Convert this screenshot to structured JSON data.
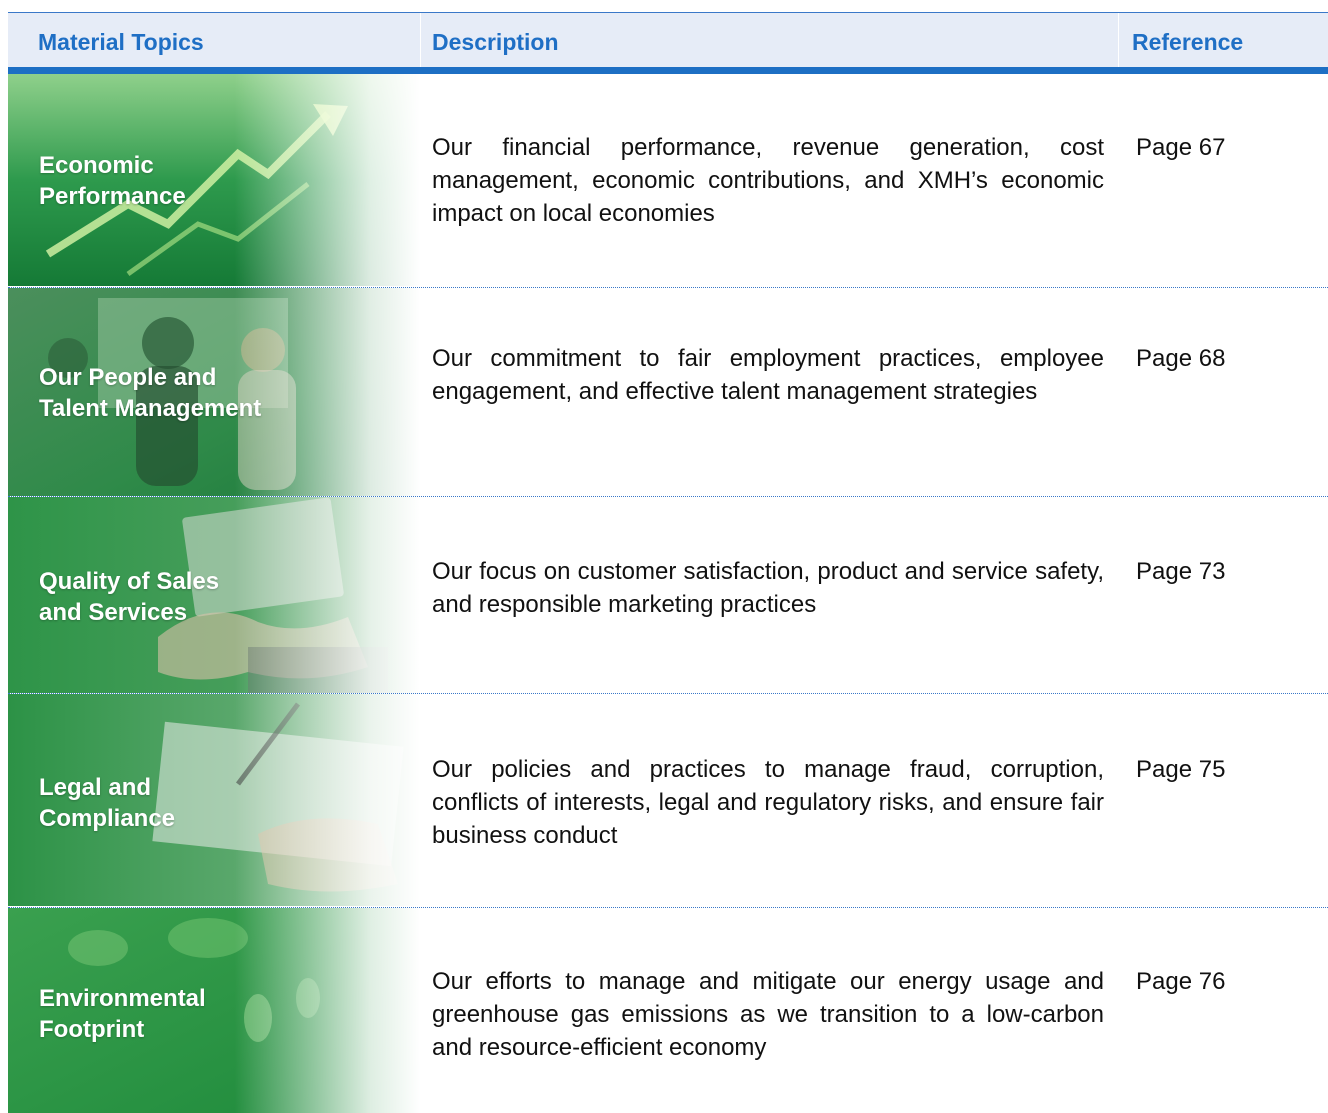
{
  "header": {
    "col_topics": "Material Topics",
    "col_description": "Description",
    "col_reference": "Reference"
  },
  "rows": [
    {
      "topic": "Economic\nPerformance",
      "description": "Our financial performance, revenue generation, cost management, economic contributions, and XMH’s economic impact on local economies",
      "reference": "Page 67"
    },
    {
      "topic": "Our People and\nTalent Management",
      "description": "Our commitment to fair employment practices, employee engagement, and effective talent management strategies",
      "reference": "Page 68"
    },
    {
      "topic": "Quality of Sales\nand Services",
      "description": "Our focus on customer satisfaction, product and service safety, and responsible marketing practices",
      "reference": "Page 73"
    },
    {
      "topic": "Legal and\nCompliance",
      "description": "Our policies and practices to manage fraud, corruption, conflicts of interests, legal and regulatory risks, and ensure fair business conduct",
      "reference": "Page 75"
    },
    {
      "topic": "Environmental\nFootprint",
      "description": "Our efforts to manage and mitigate our energy usage and greenhouse gas emissions as we transition to a low-carbon and resource-efficient economy",
      "reference": "Page 76"
    }
  ],
  "colors": {
    "header_text": "#1f6fc5",
    "header_bg": "#e6ecf7",
    "header_rule": "#1d6fc4",
    "topic_green": "#1f8f3f"
  }
}
